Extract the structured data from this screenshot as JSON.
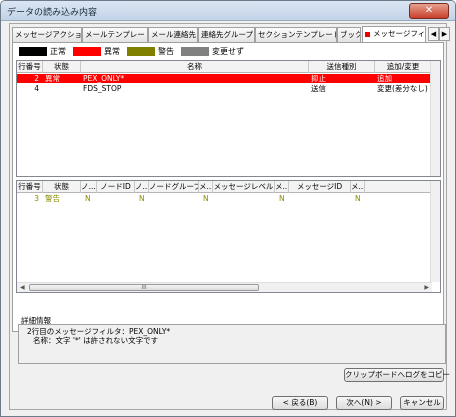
{
  "window": {
    "title": "データの読み込み内容",
    "close_label": "✕"
  },
  "tabs": [
    "メッセージアクション",
    "メールテンプレート",
    "メール連絡先",
    "連絡先グループ",
    "セクションテンプレート",
    "ブック",
    "メッセージフィルタ"
  ],
  "tab_scroll": {
    "left": "◀",
    "right": "▶"
  },
  "legend": [
    {
      "label": "正常",
      "color": "#000000"
    },
    {
      "label": "異常",
      "color": "#ff0000"
    },
    {
      "label": "警告",
      "color": "#808000"
    },
    {
      "label": "変更せず",
      "color": "#808080"
    }
  ],
  "top_grid": {
    "headers": [
      "行番号",
      "状態",
      "名称",
      "送信種別",
      "追加/変更"
    ],
    "rows": [
      {
        "num": "2",
        "status": "異常",
        "name": "PEX_ONLY*",
        "type": "抑止",
        "change": "追加",
        "selected": true
      },
      {
        "num": "4",
        "status": "",
        "name": "FDS_STOP",
        "type": "送信",
        "change": "変更(差分なし)",
        "selected": false
      }
    ]
  },
  "bottom_grid": {
    "headers": [
      "行番号",
      "状態",
      "ノ...",
      "ノードID",
      "ノ...",
      "ノードグループID",
      "メ...",
      "メッセージレベル",
      "メ...",
      "メッセージID",
      "メ...",
      "..."
    ],
    "rows": [
      {
        "num": "3",
        "status": "警告",
        "c1": "N",
        "c3": "N",
        "c5": "N",
        "c7": "N",
        "c9": "N"
      }
    ],
    "scroll_thumb": "III"
  },
  "detail": {
    "label": "詳細情報",
    "line1": "2行目のメッセージフィルタ：PEX_ONLY*",
    "line2": "名称：文字 '*' は許されない文字です"
  },
  "buttons": {
    "copy": "クリップボードへログをコピー",
    "back": "< 戻る(B)",
    "next": "次へ(N) >",
    "cancel": "キャンセル"
  }
}
